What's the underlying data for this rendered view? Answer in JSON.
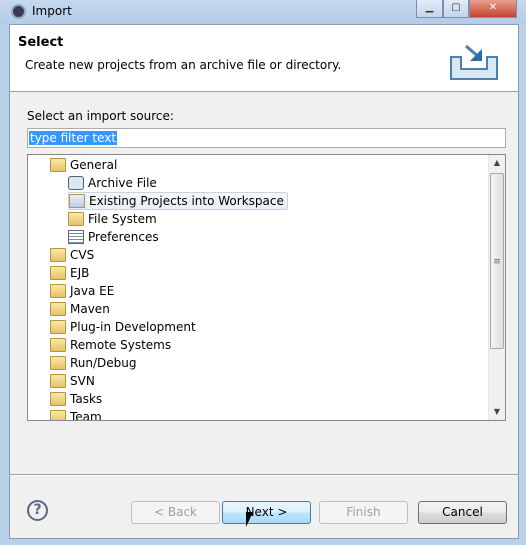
{
  "window": {
    "title": "Import",
    "controls": [
      "minimize",
      "maximize",
      "close"
    ]
  },
  "header": {
    "title": "Select",
    "description": "Create new projects from an archive file or directory.",
    "icon": "import-wizard-icon"
  },
  "source_label": "Select an import source:",
  "filter": {
    "value": "type filter text"
  },
  "tree": [
    {
      "label": "General",
      "level": 0,
      "icon": "folder-open-icon",
      "expanded": true
    },
    {
      "label": "Archive File",
      "level": 1,
      "icon": "archive-file-icon"
    },
    {
      "label": "Existing Projects into Workspace",
      "level": 1,
      "icon": "project-folder-icon",
      "selected": true
    },
    {
      "label": "File System",
      "level": 1,
      "icon": "folder-icon"
    },
    {
      "label": "Preferences",
      "level": 1,
      "icon": "preferences-icon"
    },
    {
      "label": "CVS",
      "level": 0,
      "icon": "folder-open-icon"
    },
    {
      "label": "EJB",
      "level": 0,
      "icon": "folder-open-icon"
    },
    {
      "label": "Java EE",
      "level": 0,
      "icon": "folder-open-icon"
    },
    {
      "label": "Maven",
      "level": 0,
      "icon": "folder-open-icon"
    },
    {
      "label": "Plug-in Development",
      "level": 0,
      "icon": "folder-open-icon"
    },
    {
      "label": "Remote Systems",
      "level": 0,
      "icon": "folder-open-icon"
    },
    {
      "label": "Run/Debug",
      "level": 0,
      "icon": "folder-open-icon"
    },
    {
      "label": "SVN",
      "level": 0,
      "icon": "folder-open-icon"
    },
    {
      "label": "Tasks",
      "level": 0,
      "icon": "folder-open-icon"
    },
    {
      "label": "Team",
      "level": 0,
      "icon": "folder-open-icon"
    }
  ],
  "buttons": {
    "back": "< Back",
    "next": "Next >",
    "finish": "Finish",
    "cancel": "Cancel",
    "help": "?"
  }
}
